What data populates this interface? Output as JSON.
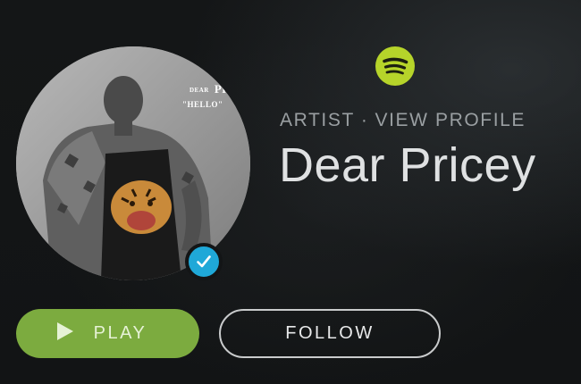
{
  "brand": {
    "logo_icon": "spotify-icon",
    "accent": "#7cab3f",
    "logo_color": "#b6d42a"
  },
  "artist": {
    "meta_type": "ARTIST",
    "meta_separator": "·",
    "meta_link": "VIEW PROFILE",
    "name": "Dear Pricey",
    "verified_color": "#1fa8d8",
    "photo": {
      "caption_small": "DEAR",
      "caption_main": "PR",
      "caption_sub": "\"HELLO\""
    }
  },
  "actions": {
    "play_label": "PLAY",
    "follow_label": "FOLLOW",
    "more_label": "•••"
  }
}
